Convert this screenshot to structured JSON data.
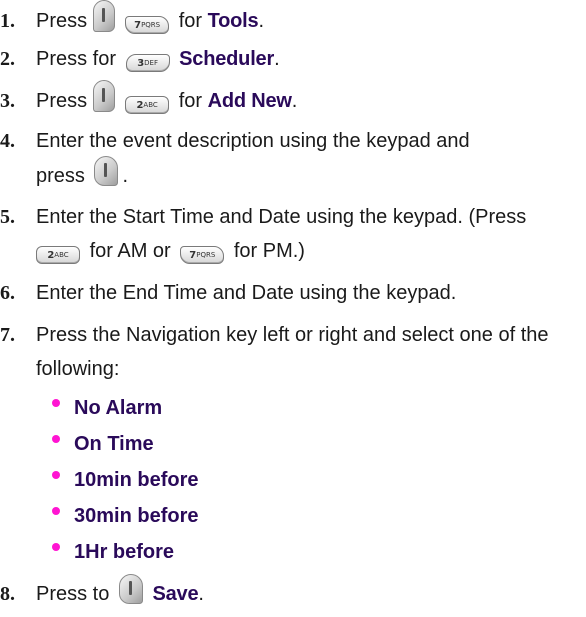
{
  "steps": [
    {
      "num": "1.",
      "parts": {
        "pre": "Press",
        "key1": "menu-key",
        "key2_main": "7",
        "key2_sub": "PQRS",
        "mid": "for",
        "bold": "Tools",
        "post": "."
      }
    },
    {
      "num": "2.",
      "parts": {
        "pre": "Press for",
        "key1_main": "3",
        "key1_sub": "DEF",
        "bold": "Scheduler",
        "post": "."
      }
    },
    {
      "num": "3.",
      "parts": {
        "pre": "Press",
        "key1": "menu-key",
        "key2_main": "2",
        "key2_sub": "ABC",
        "mid": "for",
        "bold": "Add New",
        "post": "."
      }
    },
    {
      "num": "4.",
      "line1": "Enter the event description using the keypad and",
      "line2_pre": "press",
      "line2_post": "."
    },
    {
      "num": "5.",
      "line1": "Enter the Start Time and Date using the keypad. (Press",
      "key_am_main": "2",
      "key_am_sub": "ABC",
      "am_text": "for AM or",
      "key_pm_main": "7",
      "key_pm_sub": "PQRS",
      "pm_text": "for PM.)"
    },
    {
      "num": "6.",
      "line1": "Enter the End Time and Date using the keypad."
    },
    {
      "num": "7.",
      "line1": "Press the Navigation key left or right and select one of the",
      "line2": "following:",
      "options": [
        "No Alarm",
        "On Time",
        "10min before",
        "30min before",
        "1Hr before"
      ]
    },
    {
      "num": "8.",
      "pre": "Press to",
      "bold": "Save",
      "post": "."
    }
  ],
  "colors": {
    "bullet": "#ff14d2",
    "option_text": "#2a0a5a",
    "body_text": "#1a1a1a"
  },
  "icons": {
    "menu_key": "menu-ok-key-icon",
    "ok_key": "ok-key-icon"
  }
}
